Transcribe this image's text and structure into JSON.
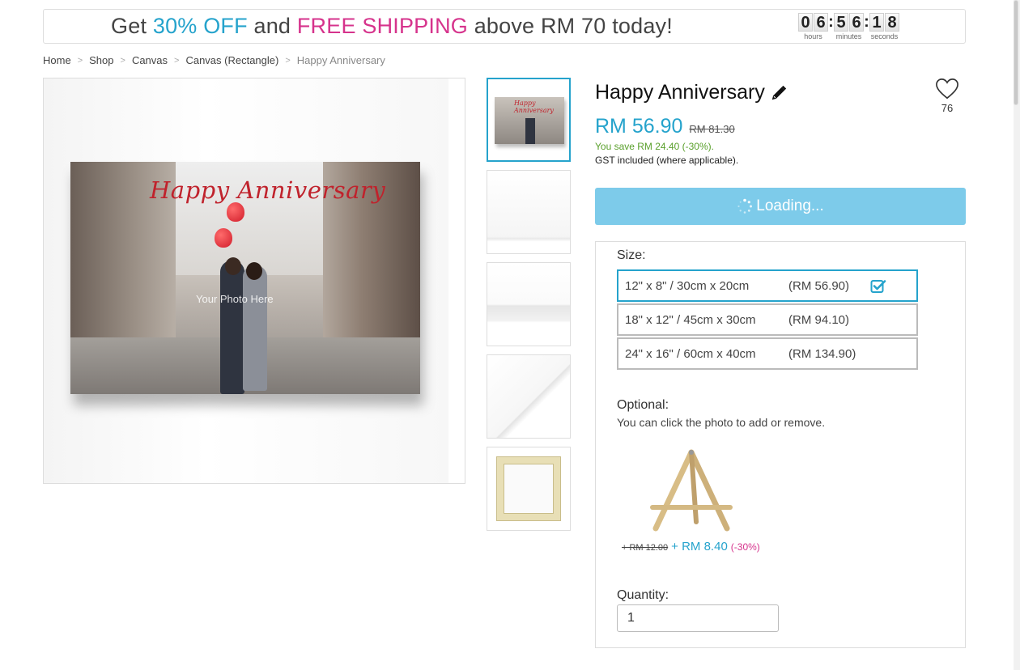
{
  "promo": {
    "get": "Get",
    "discount": "30% OFF",
    "and": "and",
    "shipping": "FREE SHIPPING",
    "rest": "above RM 70 today!",
    "countdown": {
      "h1": "0",
      "h2": "6",
      "m1": "5",
      "m2": "6",
      "s1": "1",
      "s2": "8",
      "hours_label": "hours",
      "minutes_label": "minutes",
      "seconds_label": "seconds"
    }
  },
  "breadcrumb": [
    "Home",
    "Shop",
    "Canvas",
    "Canvas (Rectangle)",
    "Happy Anniversary"
  ],
  "gallery": {
    "print_title": "Happy Anniversary",
    "placeholder": "Your Photo Here",
    "thumb_title": "Happy Anniversary"
  },
  "product": {
    "title": "Happy Anniversary",
    "favorites": "76",
    "price": "RM 56.90",
    "original_price": "RM 81.30",
    "savings": "You save RM 24.40 (-30%).",
    "gst": "GST included (where applicable).",
    "loading": "Loading..."
  },
  "options": {
    "size_label": "Size:",
    "sizes": [
      {
        "dim": "12\" x 8\" / 30cm x 20cm",
        "price": "(RM 56.90)",
        "selected": true
      },
      {
        "dim": "18\" x 12\" / 45cm x 30cm",
        "price": "(RM 94.10)",
        "selected": false
      },
      {
        "dim": "24\" x 16\" / 60cm x 40cm",
        "price": "(RM 134.90)",
        "selected": false
      }
    ],
    "optional_label": "Optional:",
    "optional_hint": "You can click the photo to add or remove.",
    "addon": {
      "was": "+ RM 12.00",
      "now": "+ RM 8.40",
      "off": "(-30%)"
    },
    "quantity_label": "Quantity:",
    "quantity_value": "1"
  },
  "colors": {
    "accent": "#25a3cc",
    "highlight": "#d6338c",
    "savings": "#5aa02c",
    "loading_button": "#7dcbea"
  }
}
